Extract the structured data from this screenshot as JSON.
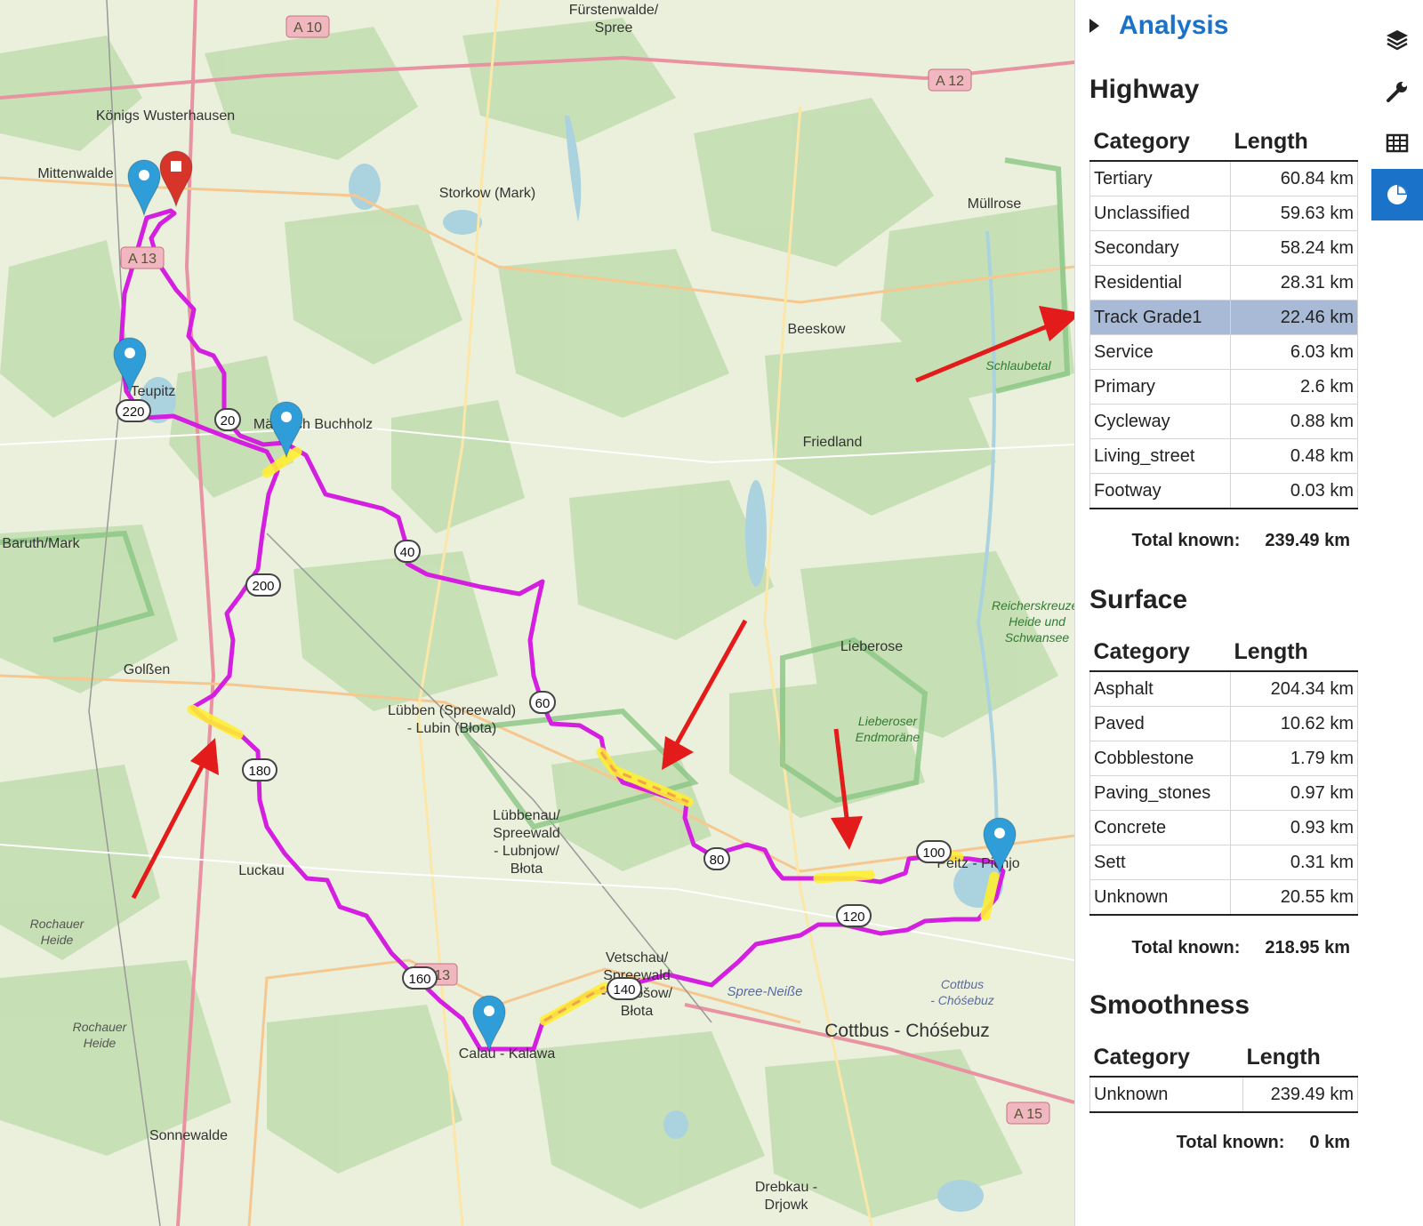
{
  "map": {
    "places": [
      {
        "name": "Fürstenwalde/\nSpree",
        "id": "fuerstenwalde"
      },
      {
        "name": "Königs Wusterhausen",
        "id": "koenigs"
      },
      {
        "name": "Mittenwalde",
        "id": "mittenwalde"
      },
      {
        "name": "Storkow (Mark)",
        "id": "storkow"
      },
      {
        "name": "Müllrose",
        "id": "muellrose"
      },
      {
        "name": "Beeskow",
        "id": "beeskow"
      },
      {
        "name": "Schlaubetal",
        "id": "schlaubetal"
      },
      {
        "name": "Friedland",
        "id": "friedland"
      },
      {
        "name": "Baruth/Mark",
        "id": "baruth"
      },
      {
        "name": "Teupitz",
        "id": "teupitz"
      },
      {
        "name": "Märkisch Buchholz",
        "id": "buchholz"
      },
      {
        "name": "Golßen",
        "id": "golssen"
      },
      {
        "name": "Lübben (Spreewald)\n- Lubin (Błota)",
        "id": "luebben"
      },
      {
        "name": "Lieberose",
        "id": "lieberose"
      },
      {
        "name": "Reicherskreuzer\nHeide und\nSchwansee",
        "id": "reicherskreuz"
      },
      {
        "name": "Lieberoser\nEndmoräne",
        "id": "lieberoser_end"
      },
      {
        "name": "Lübbenau/\nSpreewald\n- Lubnjow/\nBłota",
        "id": "luebbenau"
      },
      {
        "name": "Luckau",
        "id": "luckau"
      },
      {
        "name": "Rochauer\nHeide",
        "id": "rochauer1"
      },
      {
        "name": "Rochauer\nHeide",
        "id": "rochauer2"
      },
      {
        "name": "Peitz - Picnjo",
        "id": "peitz"
      },
      {
        "name": "Vetschau/\nSpreewald\n- Wětošow/\nBłota",
        "id": "vetschau"
      },
      {
        "name": "Spree-Neiße",
        "id": "spreeneisse"
      },
      {
        "name": "Cottbus - Chóśebuz",
        "id": "cottbus"
      },
      {
        "name": "Cottbus\n- Chóśebuz",
        "id": "cottbus_small"
      },
      {
        "name": "Calau - Kalawa",
        "id": "calau"
      },
      {
        "name": "Sonnewalde",
        "id": "sonnewalde"
      },
      {
        "name": "Drebkau -\nDrjowk",
        "id": "drebkau"
      }
    ],
    "highways": [
      "A 10",
      "A 12",
      "A 13",
      "A 13",
      "A 15"
    ],
    "distance_markers": [
      "20",
      "40",
      "60",
      "80",
      "100",
      "120",
      "140",
      "160",
      "180",
      "200",
      "220"
    ]
  },
  "analysis": {
    "title": "Analysis",
    "sections": [
      {
        "title": "Highway",
        "col_category": "Category",
        "col_length": "Length",
        "rows": [
          {
            "category": "Tertiary",
            "length": "60.84 km"
          },
          {
            "category": "Unclassified",
            "length": "59.63 km"
          },
          {
            "category": "Secondary",
            "length": "58.24 km"
          },
          {
            "category": "Residential",
            "length": "28.31 km"
          },
          {
            "category": "Track Grade1",
            "length": "22.46 km",
            "highlight": true
          },
          {
            "category": "Service",
            "length": "6.03 km"
          },
          {
            "category": "Primary",
            "length": "2.6 km"
          },
          {
            "category": "Cycleway",
            "length": "0.88 km"
          },
          {
            "category": "Living_street",
            "length": "0.48 km"
          },
          {
            "category": "Footway",
            "length": "0.03 km"
          }
        ],
        "total_label": "Total known:",
        "total_value": "239.49 km"
      },
      {
        "title": "Surface",
        "col_category": "Category",
        "col_length": "Length",
        "rows": [
          {
            "category": "Asphalt",
            "length": "204.34 km"
          },
          {
            "category": "Paved",
            "length": "10.62 km"
          },
          {
            "category": "Cobblestone",
            "length": "1.79 km"
          },
          {
            "category": "Paving_stones",
            "length": "0.97 km"
          },
          {
            "category": "Concrete",
            "length": "0.93 km"
          },
          {
            "category": "Sett",
            "length": "0.31 km"
          },
          {
            "category": "Unknown",
            "length": "20.55 km"
          }
        ],
        "total_label": "Total known:",
        "total_value": "218.95 km"
      },
      {
        "title": "Smoothness",
        "col_category": "Category",
        "col_length": "Length",
        "rows": [
          {
            "category": "Unknown",
            "length": "239.49 km"
          }
        ],
        "total_label": "Total known:",
        "total_value": "0 km"
      }
    ]
  },
  "sidebar": {
    "buttons": [
      {
        "icon": "layers-icon",
        "active": false
      },
      {
        "icon": "wrench-icon",
        "active": false
      },
      {
        "icon": "table-icon",
        "active": false
      },
      {
        "icon": "pie-chart-icon",
        "active": true
      }
    ]
  },
  "colors": {
    "route": "#d41fe0",
    "highlight": "#ffee33",
    "arrow": "#e41b1b",
    "accent": "#1a73c8",
    "marker": "#2f9ed8",
    "marker_end": "#d8352a"
  }
}
